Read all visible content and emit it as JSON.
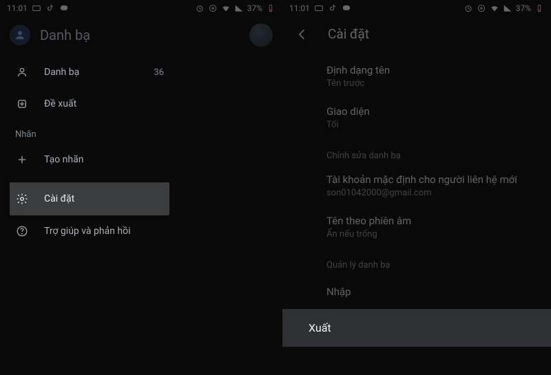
{
  "statusbar": {
    "time": "11:01",
    "battery_text": "37%"
  },
  "left": {
    "app_title": "Danh bạ",
    "rows": {
      "contacts_label": "Danh bạ",
      "contacts_count": "36",
      "suggestions_label": "Đề xuất",
      "labels_section": "Nhãn",
      "create_label": "Tạo nhãn",
      "settings_label": "Cài đặt",
      "help_label": "Trợ giúp và phản hồi"
    }
  },
  "right": {
    "title": "Cài đặt",
    "name_format": {
      "primary": "Định dạng tên",
      "secondary": "Tên trước"
    },
    "theme": {
      "primary": "Giao diện",
      "secondary": "Tối"
    },
    "edit_section": "Chỉnh sửa danh bạ",
    "default_account": {
      "primary": "Tài khoản mặc định cho người liên hệ mới",
      "secondary": "son01042000@gmail.com"
    },
    "phonetic": {
      "primary": "Tên theo phiên âm",
      "secondary": "Ẩn nếu trống"
    },
    "manage_section": "Quản lý danh bạ",
    "import_label": "Nhập",
    "export_label": "Xuất"
  }
}
